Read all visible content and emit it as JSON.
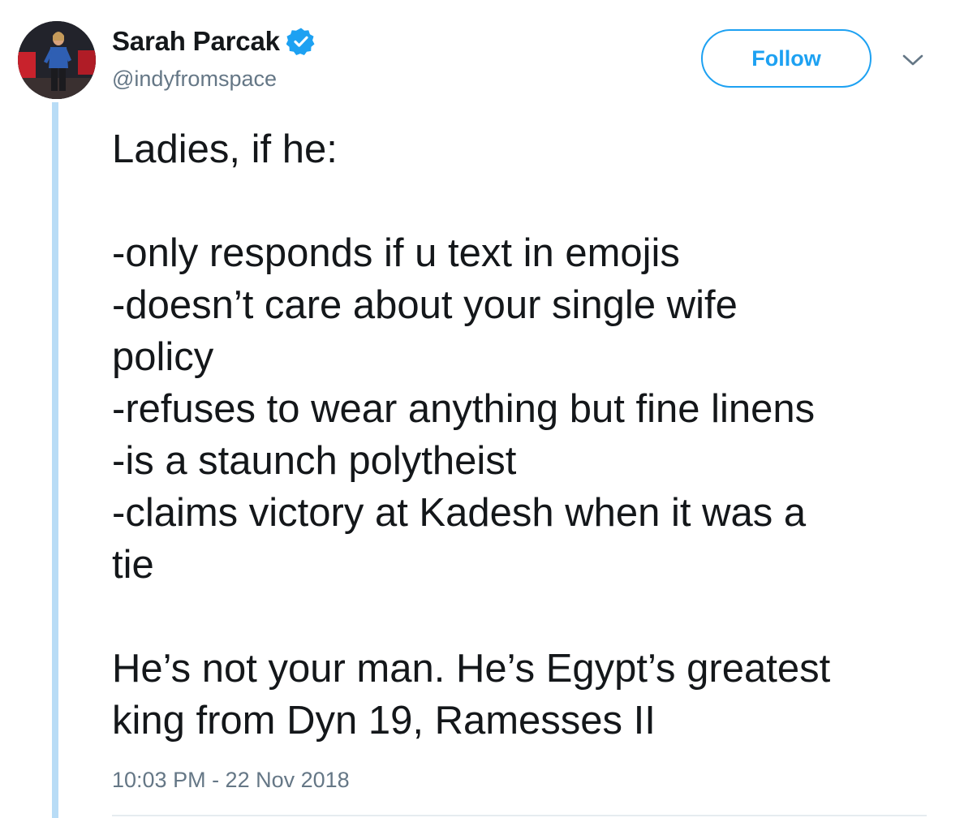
{
  "user": {
    "display_name": "Sarah Parcak",
    "handle": "@indyfromspace",
    "verified": true,
    "avatar_icon": "avatar-photo"
  },
  "actions": {
    "follow_label": "Follow",
    "more_icon": "chevron-down-icon"
  },
  "tweet": {
    "lines": [
      "Ladies, if he:",
      "",
      "-only responds if u text in emojis",
      "-doesn’t care about your single wife",
      "policy",
      "-refuses to wear anything but fine linens",
      "-is a staunch polytheist",
      "-claims victory at Kadesh when it was a",
      "tie",
      "",
      "He’s not your man. He’s Egypt’s greatest",
      "king from Dyn 19, Ramesses II"
    ],
    "timestamp": "10:03 PM - 22 Nov 2018"
  },
  "colors": {
    "accent": "#1da1f2",
    "text": "#14171a",
    "muted": "#657786",
    "thread_line": "#b8dcf6"
  }
}
